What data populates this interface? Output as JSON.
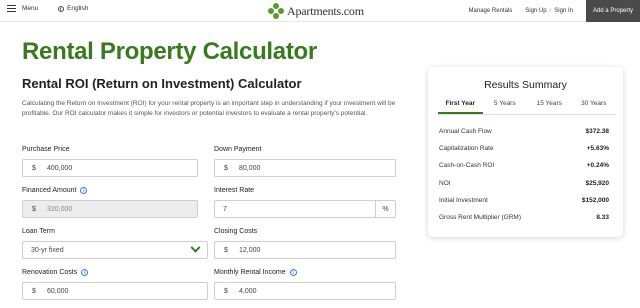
{
  "nav": {
    "menu_label": "Menu",
    "language_label": "English",
    "logo_text": "Apartments.com",
    "manage_rentals": "Manage Rentals",
    "sign_up": "Sign Up",
    "separator": "/",
    "sign_in": "Sign In",
    "add_property": "Add a Property"
  },
  "page": {
    "title": "Rental Property Calculator",
    "subtitle": "Rental ROI (Return on Investment) Calculator",
    "intro": "Calculating the Return on Investment (ROI) for your rental property is an important step in understanding if your investment will be profitable. Our ROI calculator makes it simple for investors or potential investors to evaluate a rental property's potential."
  },
  "form": {
    "purchase_price": {
      "label": "Purchase Price",
      "prefix": "$",
      "value": "400,000"
    },
    "down_payment": {
      "label": "Down Payment",
      "prefix": "$",
      "value": "80,000"
    },
    "financed_amount": {
      "label": "Financed Amount",
      "prefix": "$",
      "value": "320,000",
      "info": "i"
    },
    "interest_rate": {
      "label": "Interest Rate",
      "value": "7",
      "suffix": "%"
    },
    "loan_term": {
      "label": "Loan Term",
      "value": "30-yr fixed"
    },
    "closing_costs": {
      "label": "Closing Costs",
      "prefix": "$",
      "value": "12,000"
    },
    "renovation_costs": {
      "label": "Renovation Costs",
      "prefix": "$",
      "value": "60,000",
      "info": "i"
    },
    "monthly_rental_income": {
      "label": "Monthly Rental Income",
      "prefix": "$",
      "value": "4,000",
      "info": "i"
    }
  },
  "results": {
    "title": "Results Summary",
    "tabs": [
      "First Year",
      "5 Years",
      "15 Years",
      "30 Years"
    ],
    "active_tab": "First Year",
    "rows": [
      {
        "label": "Annual Cash Flow",
        "value": "$372.38"
      },
      {
        "label": "Capitalization Rate",
        "value": "+5.63%"
      },
      {
        "label": "Cash-on-Cash ROI",
        "value": "+0.24%"
      },
      {
        "label": "NOI",
        "value": "$25,920"
      },
      {
        "label": "Initial Investment",
        "value": "$152,000"
      },
      {
        "label": "Gross Rent Multiplier (GRM)",
        "value": "8.33"
      }
    ]
  },
  "colors": {
    "brand_green": "#3a7a1f",
    "logo_green": "#5a9a2e",
    "info_blue": "#3b7bd6",
    "add_property_bg": "#4a4a4a"
  },
  "icons": [
    "hamburger-icon",
    "globe-icon",
    "apartments-logo-icon",
    "info-icon",
    "chevron-down-icon"
  ]
}
